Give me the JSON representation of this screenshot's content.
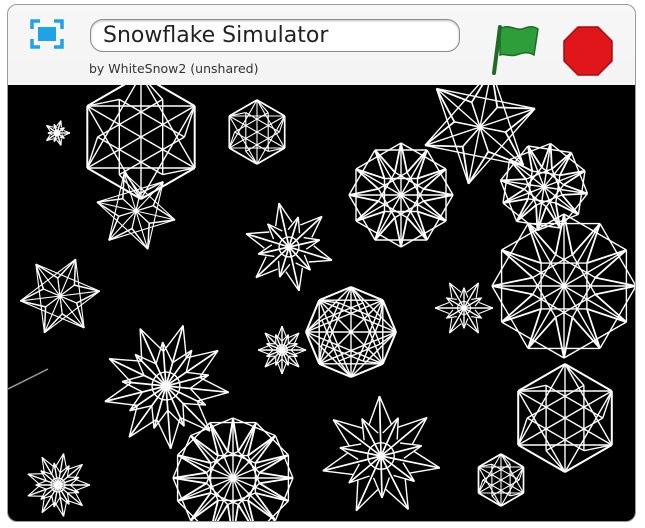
{
  "project": {
    "title": "Snowflake Simulator",
    "byline": "by WhiteSnow2 (unshared)"
  },
  "icons": {
    "fullscreen": "fullscreen-icon",
    "green_flag": "green-flag-icon",
    "stop": "stop-sign-icon"
  },
  "colors": {
    "stage_background": "#000000",
    "snowflake": "#ffffff",
    "flag": "#2e9e3a",
    "stop": "#e0161b",
    "fullscreen_icon": "#1fa3e8"
  }
}
